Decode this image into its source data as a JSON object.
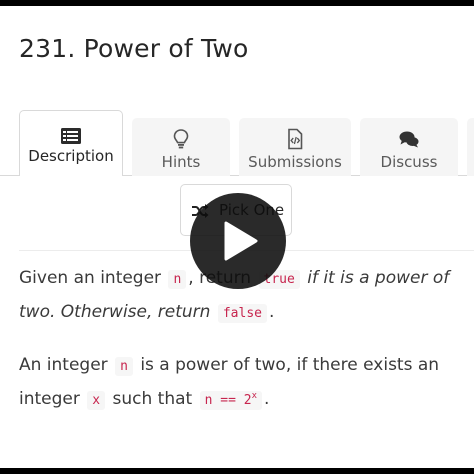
{
  "problem": {
    "title": "231. Power of Two"
  },
  "tabs": [
    {
      "label": "Description",
      "icon": "description-icon",
      "active": true
    },
    {
      "label": "Hints",
      "icon": "lightbulb-icon",
      "active": false
    },
    {
      "label": "Submissions",
      "icon": "code-file-icon",
      "active": false
    },
    {
      "label": "Discuss",
      "icon": "chat-bubbles-icon",
      "active": false
    }
  ],
  "pick_one": {
    "label": "Pick One",
    "icon": "shuffle-icon"
  },
  "player": {
    "icon": "play-icon"
  },
  "description": {
    "p1": {
      "t1": "Given an integer",
      "c1": "n",
      "t2": ", return",
      "c2": "true",
      "t3": " if it is a power of two. Otherwise, return",
      "c3": "false",
      "t4": "."
    },
    "p2": {
      "t1": "An integer",
      "c1": "n",
      "t2": "is a power of two, if there exists an integer",
      "c2": "x",
      "t3": "such that",
      "c3": "n == 2",
      "sup": "x",
      "t4": "."
    }
  },
  "colors": {
    "code_text": "#c7254e",
    "code_bg": "#f6f6f6",
    "tab_bg": "#f5f5f5"
  }
}
